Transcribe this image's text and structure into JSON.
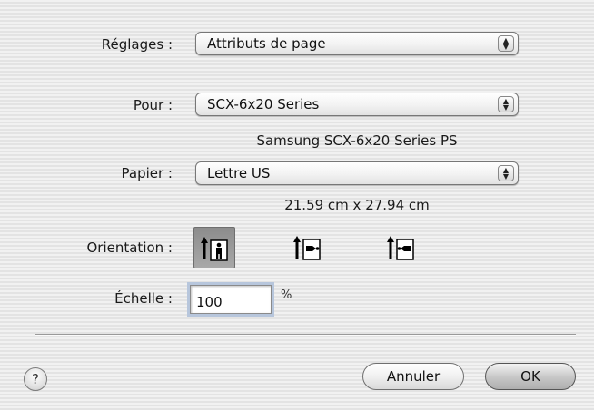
{
  "settings": {
    "label": "Réglages :",
    "value": "Attributs de page"
  },
  "printer": {
    "label": "Pour :",
    "value": "SCX-6x20 Series",
    "description": "Samsung SCX-6x20 Series PS"
  },
  "paper": {
    "label": "Papier :",
    "value": "Lettre US",
    "dimensions": "21.59 cm x 27.94 cm"
  },
  "orientation": {
    "label": "Orientation :",
    "options": [
      {
        "icon": "portrait-orientation-icon",
        "selected": true
      },
      {
        "icon": "landscape-left-orientation-icon",
        "selected": false
      },
      {
        "icon": "landscape-right-orientation-icon",
        "selected": false
      }
    ]
  },
  "scale": {
    "label": "Échelle :",
    "value": "100",
    "unit": "%"
  },
  "footer": {
    "help_glyph": "?",
    "cancel_label": "Annuler",
    "ok_label": "OK"
  }
}
